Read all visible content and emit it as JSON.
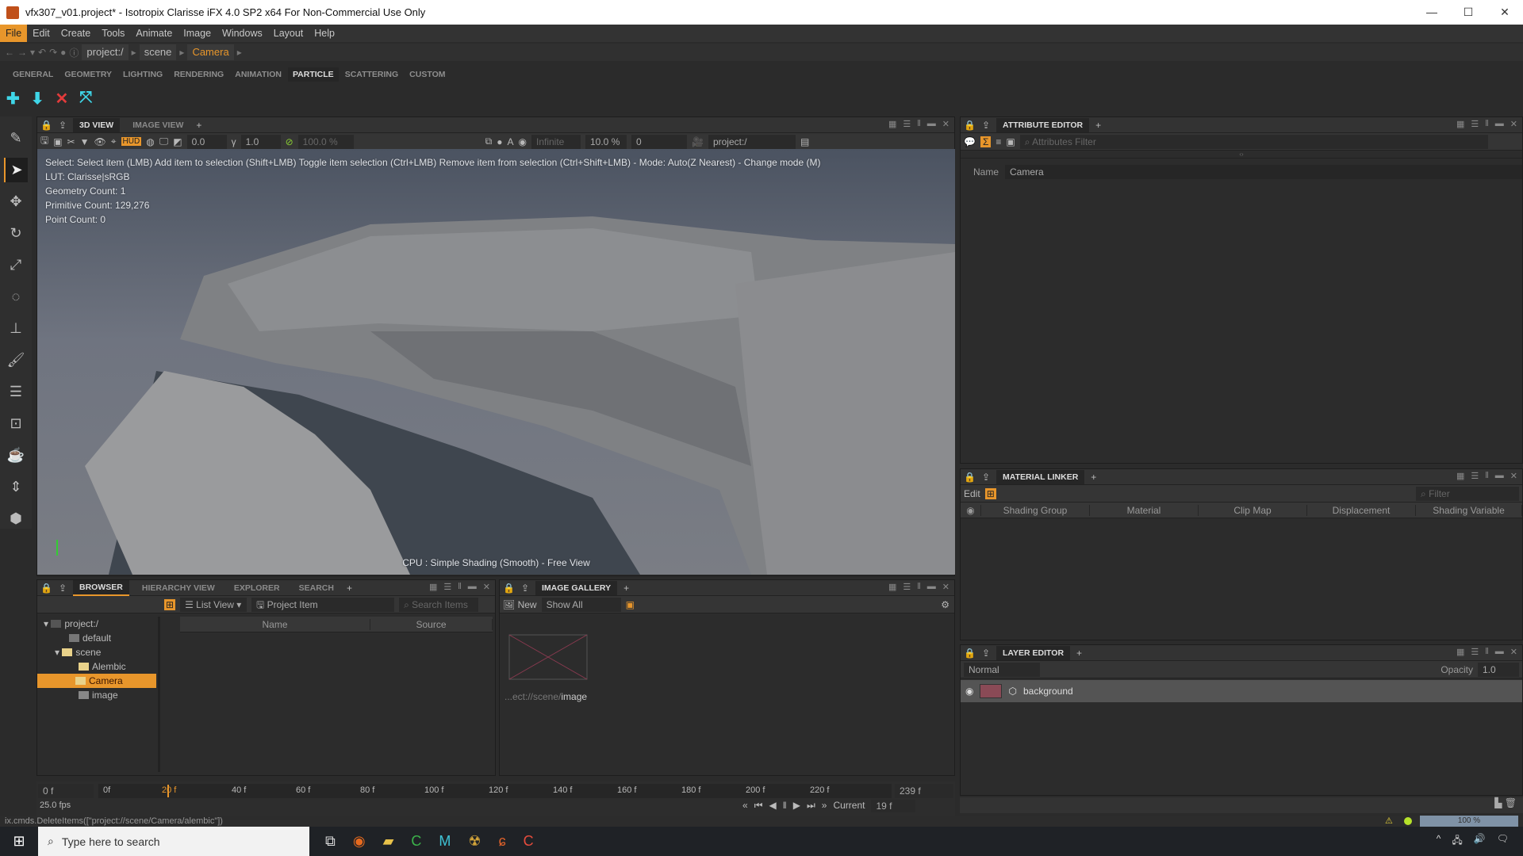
{
  "window": {
    "title": "vfx307_v01.project* - Isotropix Clarisse iFX 4.0 SP2 x64  For Non-Commercial Use Only",
    "minimize": "—",
    "maximize": "☐",
    "close": "✕"
  },
  "menu": [
    "File",
    "Edit",
    "Create",
    "Tools",
    "Animate",
    "Image",
    "Windows",
    "Layout",
    "Help"
  ],
  "breadcrumb": [
    "project:/",
    "scene",
    "Camera"
  ],
  "shelf_tabs": [
    "GENERAL",
    "GEOMETRY",
    "LIGHTING",
    "RENDERING",
    "ANIMATION",
    "PARTICLE",
    "SCATTERING",
    "CUSTOM"
  ],
  "shelf_active": "PARTICLE",
  "shelf_icons": [
    "particle-add-icon",
    "particle-drop-icon",
    "particle-delete-icon",
    "particle-scatter-icon"
  ],
  "left_tools": [
    "picker-icon",
    "select-icon",
    "move-icon",
    "rotate-icon",
    "scale-icon",
    "pivot-icon",
    "stamp-icon",
    "paint-icon",
    "paint-list-icon",
    "frame-icon",
    "teapot-icon",
    "measure-icon",
    "swap-shading-icon"
  ],
  "view3d": {
    "tabs": [
      "3D VIEW",
      "IMAGE VIEW"
    ],
    "exposure": "0.0",
    "gamma": "1.0",
    "percent": "100.0 %",
    "distance": "Infinite",
    "near": "10.0 %",
    "frame": "0",
    "context": "project:/",
    "hud_label": "HUD",
    "hud": [
      "Select: Select item (LMB)  Add item to selection (Shift+LMB)  Toggle item selection (Ctrl+LMB)  Remove item from selection (Ctrl+Shift+LMB)  - Mode: Auto(Z Nearest) - Change mode (M)",
      "LUT: Clarisse|sRGB",
      "Geometry Count: 1",
      "Primitive Count: 129,276",
      "Point Count: 0"
    ],
    "footer": "CPU : Simple Shading (Smooth) - Free View"
  },
  "browser": {
    "tabs": [
      "BROWSER",
      "HIERARCHY VIEW",
      "EXPLORER",
      "SEARCH"
    ],
    "view_mode": "List View",
    "filter": "Project Item",
    "search_placeholder": "Search Items",
    "columns": [
      "Name",
      "Source"
    ],
    "tree": [
      {
        "label": "project:/",
        "depth": 0
      },
      {
        "label": "default",
        "depth": 1
      },
      {
        "label": "scene",
        "depth": 1
      },
      {
        "label": "Alembic",
        "depth": 2
      },
      {
        "label": "Camera",
        "depth": 2,
        "selected": true
      },
      {
        "label": "image",
        "depth": 2
      }
    ]
  },
  "gallery": {
    "tab": "IMAGE GALLERY",
    "new_label": "New",
    "show": "Show All",
    "path_prefix": "...ect://scene/",
    "path_name": "image"
  },
  "attribute_editor": {
    "tab": "ATTRIBUTE EDITOR",
    "filter_placeholder": "Attributes Filter",
    "name_label": "Name",
    "name_value": "Camera"
  },
  "material_linker": {
    "tab": "MATERIAL LINKER",
    "edit_label": "Edit",
    "filter_placeholder": "Filter",
    "columns": [
      "Shading Group",
      "Material",
      "Clip Map",
      "Displacement",
      "Shading Variable"
    ]
  },
  "layer_editor": {
    "tab": "LAYER EDITOR",
    "blend": "Normal",
    "opacity_label": "Opacity",
    "opacity": "1.0",
    "layers": [
      "background"
    ]
  },
  "timeline": {
    "start": "0 f",
    "range_start": "0f",
    "ticks": [
      "40 f",
      "60 f",
      "80 f",
      "100 f",
      "120 f",
      "140 f",
      "160 f",
      "180 f",
      "200 f",
      "220 f"
    ],
    "current_marker": "20 f",
    "end": "239 f",
    "fps": "25.0 fps",
    "current_label": "Current",
    "current": "19 f"
  },
  "status": {
    "command": "ix.cmds.DeleteItems([\"project://scene/Camera/alembic\"])",
    "progress": "100 %",
    "progress_value": 1.0
  },
  "taskbar": {
    "search_placeholder": "Type here to search"
  },
  "colors": {
    "accent": "#e8962b",
    "panel": "#2c2c2c",
    "viewport_top": "#4b5361"
  }
}
